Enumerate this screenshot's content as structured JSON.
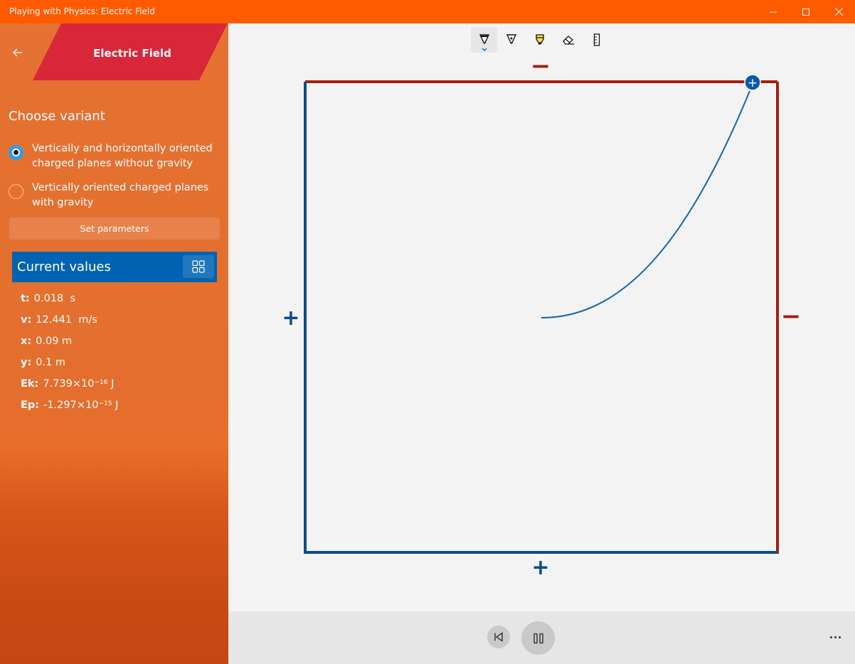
{
  "window": {
    "title": "Playing with Physics: Electric Field"
  },
  "sidebar": {
    "banner_title": "Electric Field",
    "choose_variant": "Choose variant",
    "variants": [
      {
        "label_line1": "Vertically and horizontally oriented",
        "label_line2": "charged planes without gravity",
        "selected": true
      },
      {
        "label_line1": "Vertically oriented charged planes",
        "label_line2": "with gravity",
        "selected": false
      }
    ],
    "set_parameters": "Set parameters",
    "current_values_title": "Current values",
    "values": {
      "t": {
        "key": "t:",
        "value": "0.018",
        "unit": "s"
      },
      "v": {
        "key": "v:",
        "value": "12.441",
        "unit": "m/s"
      },
      "x": {
        "key": "x:",
        "value": "0.09 m"
      },
      "y": {
        "key": "y:",
        "value": "0.1 m"
      },
      "ek": {
        "key": "Ek:",
        "mantissa": "7.739×10",
        "exponent": "−16",
        "unit": "J"
      },
      "ep": {
        "key": "Ep:",
        "mantissa": "-1.297×10",
        "exponent": "−15",
        "unit": "J"
      }
    }
  },
  "toolbar": {
    "tools": [
      "ballpoint-pen-icon",
      "pencil-icon",
      "highlighter-icon",
      "eraser-icon",
      "ruler-icon"
    ],
    "active_tool": "ballpoint-pen-icon"
  },
  "field": {
    "top_plate_sign": "−",
    "bottom_plate_sign": "+",
    "left_plate_sign": "+",
    "right_plate_sign": "−",
    "particle_sign": "+"
  },
  "colors": {
    "titlebar": "#ff5a00",
    "banner": "#d9263a",
    "negative_plate": "#a51d0f",
    "positive_plate": "#0a4c8c",
    "trajectory": "#1565a8",
    "accent": "#0063b1"
  }
}
